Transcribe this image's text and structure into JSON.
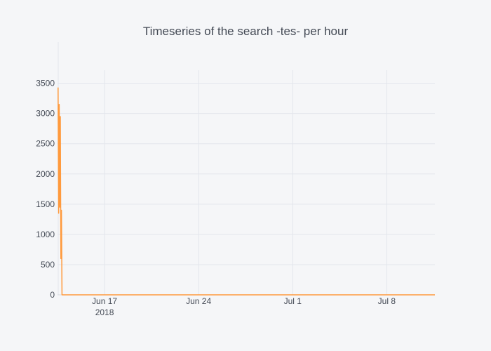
{
  "chart_data": {
    "type": "line",
    "title": "Timeseries of the search -tes- per hour",
    "xlabel": "",
    "ylabel": "",
    "x_axis": {
      "type": "date",
      "range": [
        "2018-06-13T12:00",
        "2018-07-11T14:00"
      ],
      "ticks": [
        {
          "value": "2018-06-17",
          "label": "Jun 17",
          "sublabel": "2018"
        },
        {
          "value": "2018-06-24",
          "label": "Jun 24",
          "sublabel": ""
        },
        {
          "value": "2018-07-01",
          "label": "Jul 1",
          "sublabel": ""
        },
        {
          "value": "2018-07-08",
          "label": "Jul 8",
          "sublabel": ""
        }
      ]
    },
    "y_axis": {
      "range": [
        0,
        3600
      ],
      "ticks": [
        0,
        500,
        1000,
        1500,
        2000,
        2500,
        3000,
        3500
      ]
    },
    "grid": true,
    "legend": "none",
    "series": [
      {
        "color": "#ff9a3d",
        "points": [
          {
            "x": "2018-06-13T13:00",
            "y": 3430
          },
          {
            "x": "2018-06-13T14:00",
            "y": 1350
          },
          {
            "x": "2018-06-13T15:00",
            "y": 3150
          },
          {
            "x": "2018-06-13T16:00",
            "y": 1450
          },
          {
            "x": "2018-06-13T17:00",
            "y": 2950
          },
          {
            "x": "2018-06-13T18:00",
            "y": 600
          },
          {
            "x": "2018-06-13T19:00",
            "y": 1400
          },
          {
            "x": "2018-06-13T20:00",
            "y": 0
          },
          {
            "x": "2018-06-14T00:00",
            "y": 0
          },
          {
            "x": "2018-06-20T00:00",
            "y": 0
          },
          {
            "x": "2018-06-27T00:00",
            "y": 0
          },
          {
            "x": "2018-07-04T00:00",
            "y": 0
          },
          {
            "x": "2018-07-11T14:00",
            "y": 0
          }
        ]
      }
    ]
  }
}
